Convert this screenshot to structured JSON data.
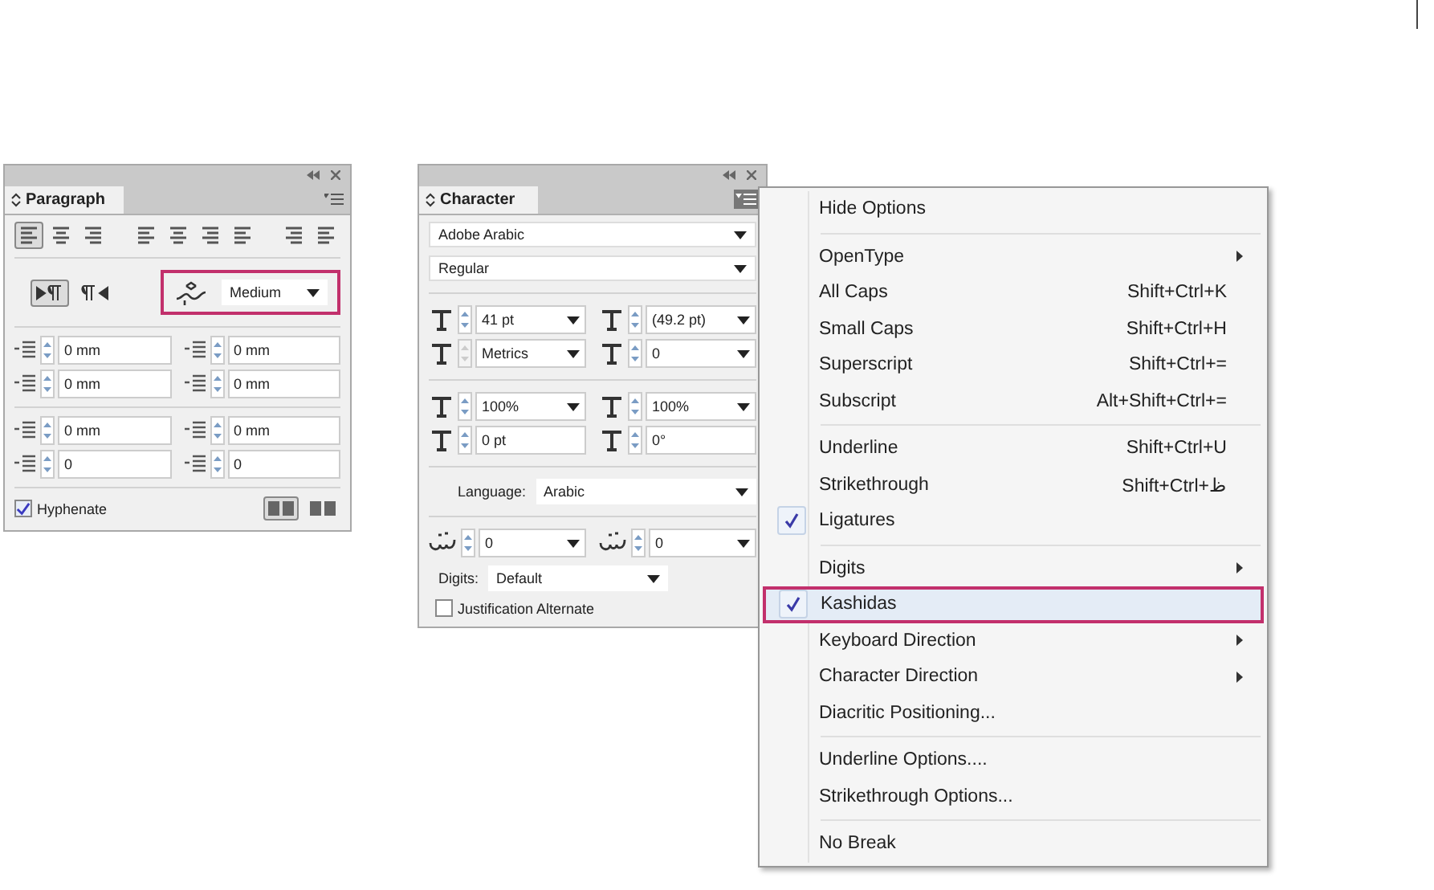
{
  "paragraph_panel": {
    "title": "Paragraph",
    "alignment_buttons": [
      {
        "selected": true
      },
      {
        "selected": false
      },
      {
        "selected": false
      },
      {
        "selected": false
      },
      {
        "selected": false
      },
      {
        "selected": false
      },
      {
        "selected": false
      },
      {
        "selected": false
      },
      {
        "selected": false
      }
    ],
    "direction_buttons": [
      {
        "selected": true
      },
      {
        "selected": false
      }
    ],
    "kashida": {
      "value": "Medium",
      "highlighted": true
    },
    "field_groups": [
      [
        {
          "value": "0 mm"
        },
        {
          "value": "0 mm"
        },
        {
          "value": "0 mm"
        },
        {
          "value": "0 mm"
        }
      ],
      [
        {
          "value": "0 mm"
        },
        {
          "value": "0 mm"
        },
        {
          "value": "0"
        },
        {
          "value": "0"
        }
      ]
    ],
    "hyphenate": {
      "label": "Hyphenate",
      "checked": true
    },
    "layout_buttons": [
      {
        "selected": true
      },
      {
        "selected": false
      }
    ]
  },
  "character_panel": {
    "title": "Character",
    "font": "Adobe Arabic",
    "style": "Regular",
    "field_groups": [
      [
        {
          "value": "41 pt",
          "kind": "combo",
          "disabled": false
        },
        {
          "value": "(49.2 pt)",
          "kind": "combo",
          "disabled": false
        },
        {
          "value": "Metrics",
          "kind": "combo",
          "disabled": true
        },
        {
          "value": "0",
          "kind": "combo",
          "disabled": false
        }
      ],
      [
        {
          "value": "100%",
          "kind": "combo",
          "disabled": false
        },
        {
          "value": "100%",
          "kind": "combo",
          "disabled": false
        },
        {
          "value": "0 pt",
          "kind": "text",
          "disabled": false
        },
        {
          "value": "0°",
          "kind": "text",
          "disabled": false
        }
      ]
    ],
    "language": {
      "label": "Language:",
      "value": "Arabic"
    },
    "arabic_fields": [
      {
        "value": "0"
      },
      {
        "value": "0"
      }
    ],
    "digits": {
      "label": "Digits:",
      "value": "Default"
    },
    "justification_alternate": {
      "label": "Justification Alternate",
      "checked": false
    }
  },
  "menu": {
    "items": [
      {
        "kind": "item",
        "label": "Hide Options",
        "checked": false,
        "highlighted": false,
        "submenu": false
      },
      {
        "kind": "separator"
      },
      {
        "kind": "item",
        "label": "OpenType",
        "checked": false,
        "highlighted": false,
        "submenu": true
      },
      {
        "kind": "item",
        "label": "All Caps",
        "shortcut": "Shift+Ctrl+K",
        "checked": false,
        "highlighted": false,
        "submenu": false
      },
      {
        "kind": "item",
        "label": "Small Caps",
        "shortcut": "Shift+Ctrl+H",
        "checked": false,
        "highlighted": false,
        "submenu": false
      },
      {
        "kind": "item",
        "label": "Superscript",
        "shortcut": "Shift+Ctrl+=",
        "checked": false,
        "highlighted": false,
        "submenu": false
      },
      {
        "kind": "item",
        "label": "Subscript",
        "shortcut": "Alt+Shift+Ctrl+=",
        "checked": false,
        "highlighted": false,
        "submenu": false
      },
      {
        "kind": "separator"
      },
      {
        "kind": "item",
        "label": "Underline",
        "shortcut": "Shift+Ctrl+U",
        "checked": false,
        "highlighted": false,
        "submenu": false
      },
      {
        "kind": "item",
        "label": "Strikethrough",
        "shortcut": "Shift+Ctrl+ظ",
        "checked": false,
        "highlighted": false,
        "submenu": false
      },
      {
        "kind": "item",
        "label": "Ligatures",
        "checked": true,
        "highlighted": false,
        "submenu": false
      },
      {
        "kind": "separator"
      },
      {
        "kind": "item",
        "label": "Digits",
        "checked": false,
        "highlighted": false,
        "submenu": true
      },
      {
        "kind": "item",
        "label": "Kashidas",
        "checked": true,
        "highlighted": true,
        "submenu": false
      },
      {
        "kind": "item",
        "label": "Keyboard Direction",
        "checked": false,
        "highlighted": false,
        "submenu": true
      },
      {
        "kind": "item",
        "label": "Character Direction",
        "checked": false,
        "highlighted": false,
        "submenu": true
      },
      {
        "kind": "item",
        "label": "Diacritic Positioning...",
        "checked": false,
        "highlighted": false,
        "submenu": false
      },
      {
        "kind": "separator"
      },
      {
        "kind": "item",
        "label": "Underline Options....",
        "checked": false,
        "highlighted": false,
        "submenu": false
      },
      {
        "kind": "item",
        "label": "Strikethrough Options...",
        "checked": false,
        "highlighted": false,
        "submenu": false
      },
      {
        "kind": "separator"
      },
      {
        "kind": "item",
        "label": "No Break",
        "checked": false,
        "highlighted": false,
        "submenu": false
      }
    ]
  }
}
